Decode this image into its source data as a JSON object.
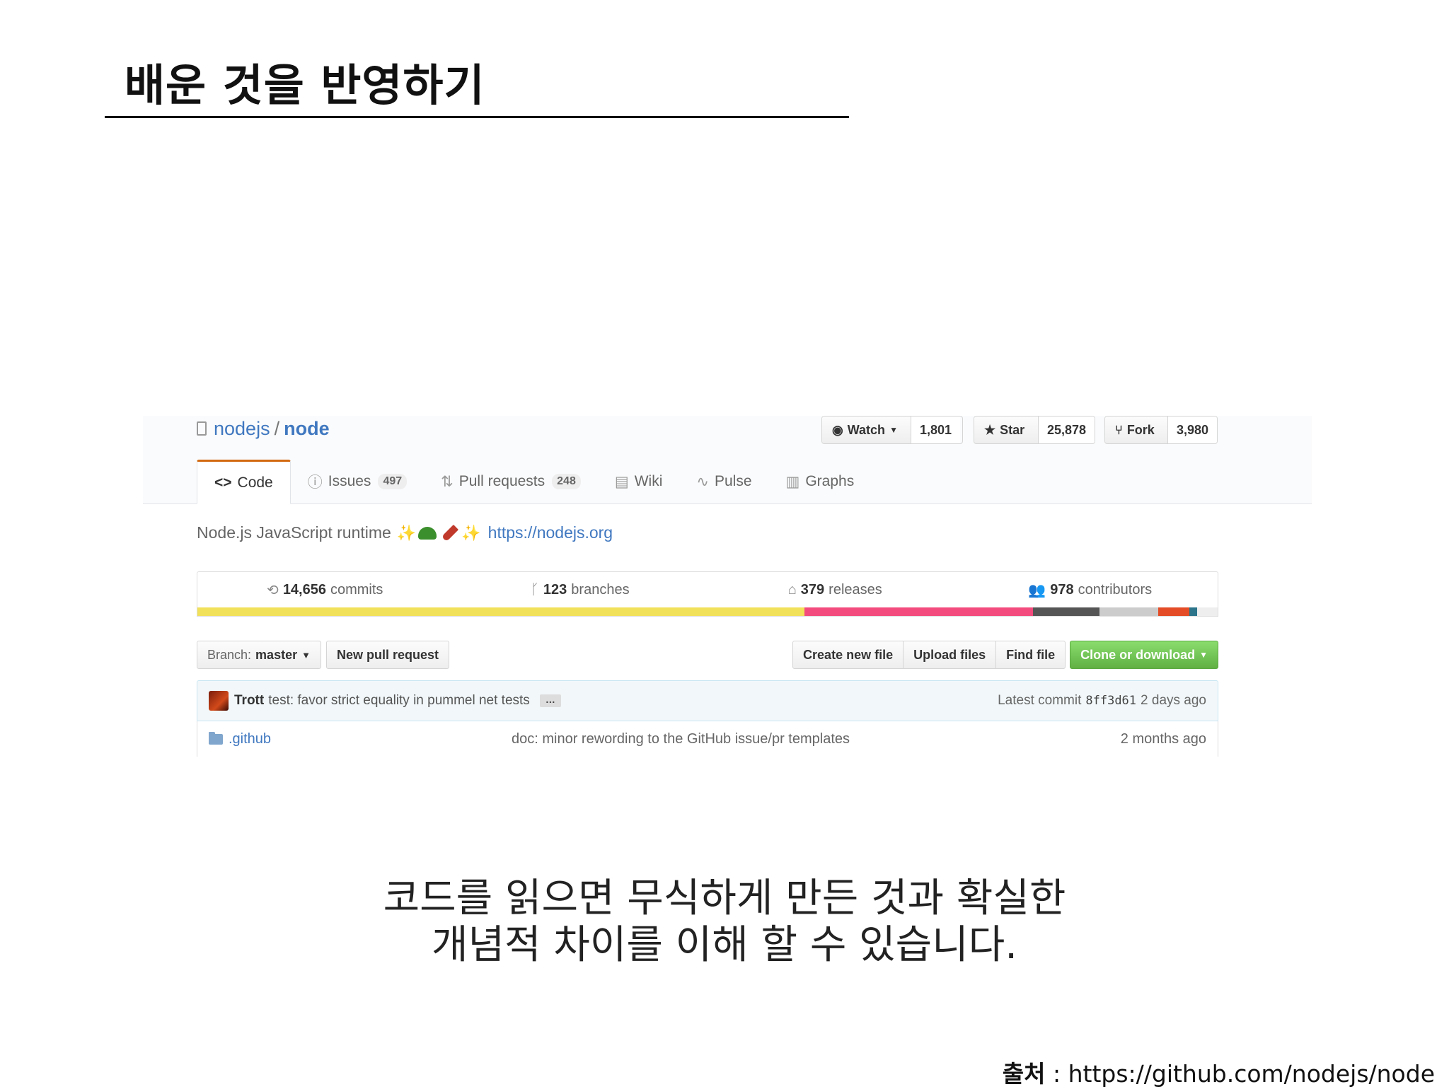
{
  "slide": {
    "title": "배운 것을 반영하기",
    "caption_line1": "코드를 읽으면 무식하게 만든 것과 확실한",
    "caption_line2": "개념적 차이를 이해 할 수 있습니다.",
    "source_label": "출처",
    "source_sep": " : ",
    "source_url": "https://github.com/nodejs/node"
  },
  "repo": {
    "owner": "nodejs",
    "separator": "/",
    "name": "node",
    "description": "Node.js JavaScript runtime",
    "homepage": "https://nodejs.org",
    "social": {
      "watch_label": "Watch",
      "watch_count": "1,801",
      "star_label": "Star",
      "star_count": "25,878",
      "fork_label": "Fork",
      "fork_count": "3,980"
    },
    "tabs": [
      {
        "label": "Code",
        "counter": ""
      },
      {
        "label": "Issues",
        "counter": "497"
      },
      {
        "label": "Pull requests",
        "counter": "248"
      },
      {
        "label": "Wiki",
        "counter": ""
      },
      {
        "label": "Pulse",
        "counter": ""
      },
      {
        "label": "Graphs",
        "counter": ""
      }
    ],
    "summary": [
      {
        "num": "14,656",
        "label": "commits"
      },
      {
        "num": "123",
        "label": "branches"
      },
      {
        "num": "379",
        "label": "releases"
      },
      {
        "num": "978",
        "label": "contributors"
      }
    ],
    "languages": [
      {
        "color": "#f1e05a",
        "share": 59.5
      },
      {
        "color": "#f34b7d",
        "share": 22.4
      },
      {
        "color": "#555555",
        "share": 6.5
      },
      {
        "color": "#cccccc",
        "share": 5.8
      },
      {
        "color": "#e34c26",
        "share": 3.0
      },
      {
        "color": "#2b7489",
        "share": 0.8
      },
      {
        "color": "#eeeeee",
        "share": 2.0
      }
    ],
    "file_nav": {
      "branch_label": "Branch:",
      "branch_value": "master",
      "new_pr": "New pull request",
      "create_file": "Create new file",
      "upload_files": "Upload files",
      "find_file": "Find file",
      "clone": "Clone or download"
    },
    "latest_commit": {
      "author": "Trott",
      "message": "test: favor strict equality in pummel net tests",
      "ellipsis": "…",
      "label": "Latest commit",
      "sha": "8ff3d61",
      "age": "2 days ago"
    },
    "files": [
      {
        "name": ".github",
        "message": "doc: minor rewording to the GitHub issue/pr templates",
        "age": "2 months ago"
      }
    ]
  },
  "colors": {
    "link": "#4078c0",
    "tab_accent": "#d26911",
    "clone_green": "#60b044"
  }
}
